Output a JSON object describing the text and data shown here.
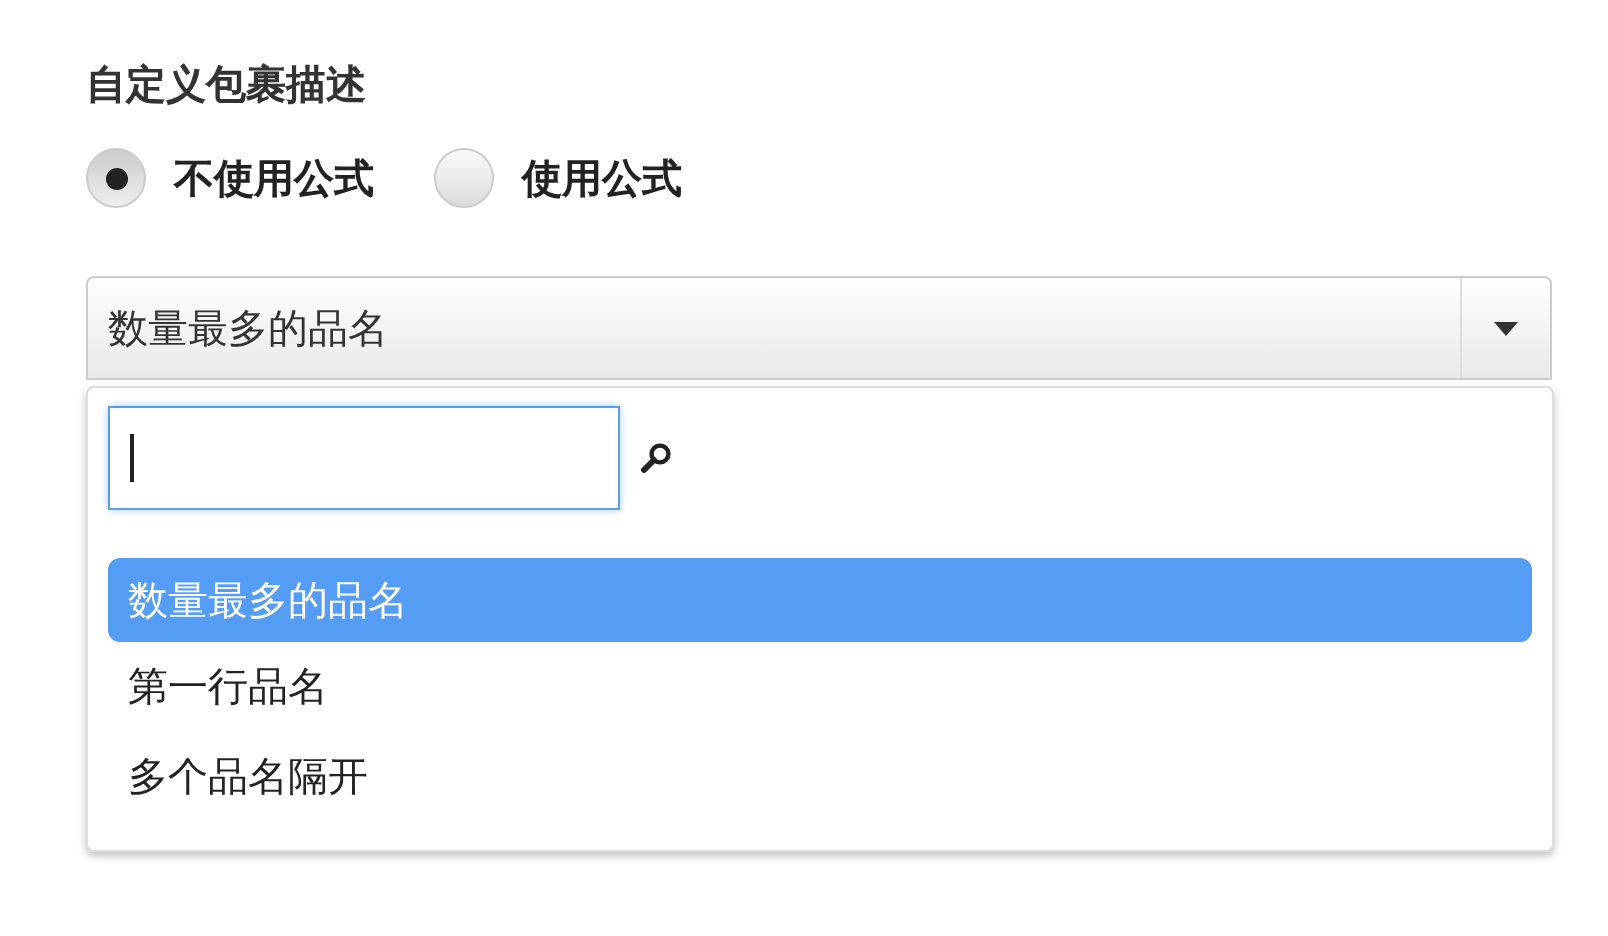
{
  "title": "自定义包裹描述",
  "radios": [
    {
      "label": "不使用公式",
      "selected": true
    },
    {
      "label": "使用公式",
      "selected": false
    }
  ],
  "select": {
    "value": "数量最多的品名",
    "expanded": true
  },
  "options": [
    {
      "label": "数量最多的品名",
      "selected": true
    },
    {
      "label": "第一行品名",
      "selected": false
    },
    {
      "label": "多个品名隔开",
      "selected": false
    }
  ]
}
